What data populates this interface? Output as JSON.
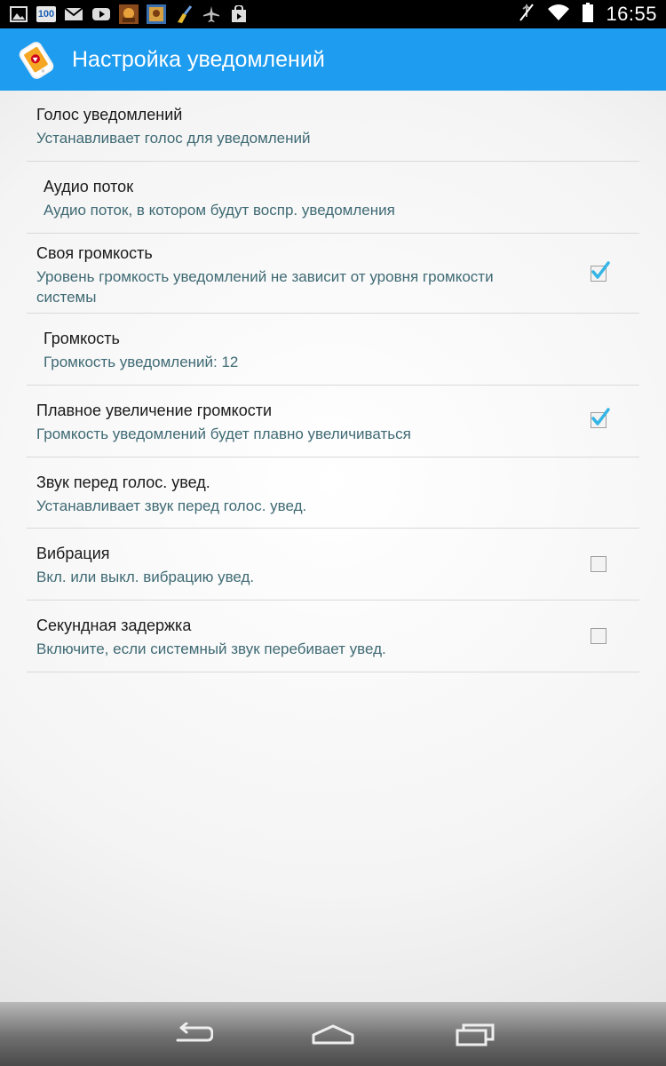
{
  "status_bar": {
    "time": "16:55",
    "battery_pct": 1.0,
    "left_icons": [
      "image-notification-icon",
      "badge-100-icon",
      "gmail-icon",
      "youtube-icon",
      "game-app-icon",
      "photo-app-icon",
      "cleaner-app-icon",
      "airplane-icon",
      "store-bag-icon"
    ],
    "right_icons": [
      "mute-icon",
      "wifi-icon",
      "battery-icon"
    ],
    "badge_text": "100"
  },
  "action_bar": {
    "title": "Настройка уведомлений",
    "color": "#1e9cf0"
  },
  "preferences": [
    {
      "title": "Голос уведомлений",
      "summary": "Устанавливает голос для уведомлений"
    },
    {
      "title": "Аудио поток",
      "summary": "Аудио поток, в котором будут воспр. уведомления"
    },
    {
      "title": "Своя громкость",
      "summary": "Уровень громкость уведомлений не зависит от уровня громкости системы",
      "checked": true
    },
    {
      "title": "Громкость",
      "summary": "Громкость уведомлений: 12"
    },
    {
      "title": "Плавное увеличение громкости",
      "summary": "Громкость уведомлений будет плавно увеличиваться",
      "checked": true
    },
    {
      "title": "Звук перед голос. увед.",
      "summary": "Устанавливает звук перед голос. увед."
    },
    {
      "title": "Вибрация",
      "summary": "Вкл. или выкл. вибрацию увед.",
      "checked": false
    },
    {
      "title": "Секундная задержка",
      "summary": "Включите, если системный звук перебивает увед.",
      "checked": false
    }
  ],
  "nav_bar": {
    "icons": [
      "back-icon",
      "home-icon",
      "recents-icon"
    ]
  },
  "colors": {
    "accent": "#1e9cf0",
    "summary_text": "#3f6a74",
    "checkmark": "#33b5e5"
  }
}
